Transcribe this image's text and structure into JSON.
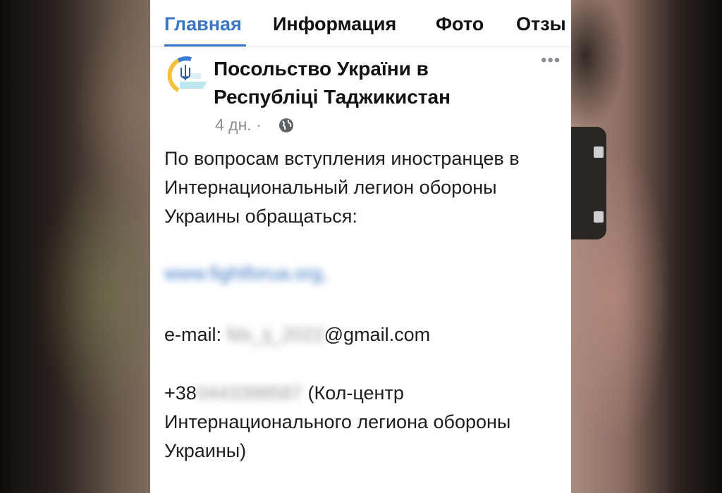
{
  "tabs": [
    {
      "label": "Главная"
    },
    {
      "label": "Информация"
    },
    {
      "label": "Фото"
    },
    {
      "label": "Отзы"
    }
  ],
  "post": {
    "author": "Посольство України в Республіці Таджикистан",
    "time": "4 дн.",
    "separator": "·",
    "more": "•••",
    "paragraph": "По вопросам вступления иностранцев в Интернациональный легион обороны Украины обращаться:",
    "website_blurred": "www.fightforua.org,",
    "email_prefix": "e-mail: ",
    "email_blurred": "fds_ij_2022",
    "email_suffix": "@gmail.com",
    "phone_prefix": "+38",
    "phone_blurred": "0443399587",
    "phone_note": " (Кол-центр Интернационального легиона обороны Украины)"
  },
  "colors": {
    "accent": "#3b77c4",
    "text": "#1c1e21",
    "muted": "#8a8d91"
  },
  "icons": [
    "trident-logo-icon",
    "more-options-icon",
    "globe-icon"
  ]
}
